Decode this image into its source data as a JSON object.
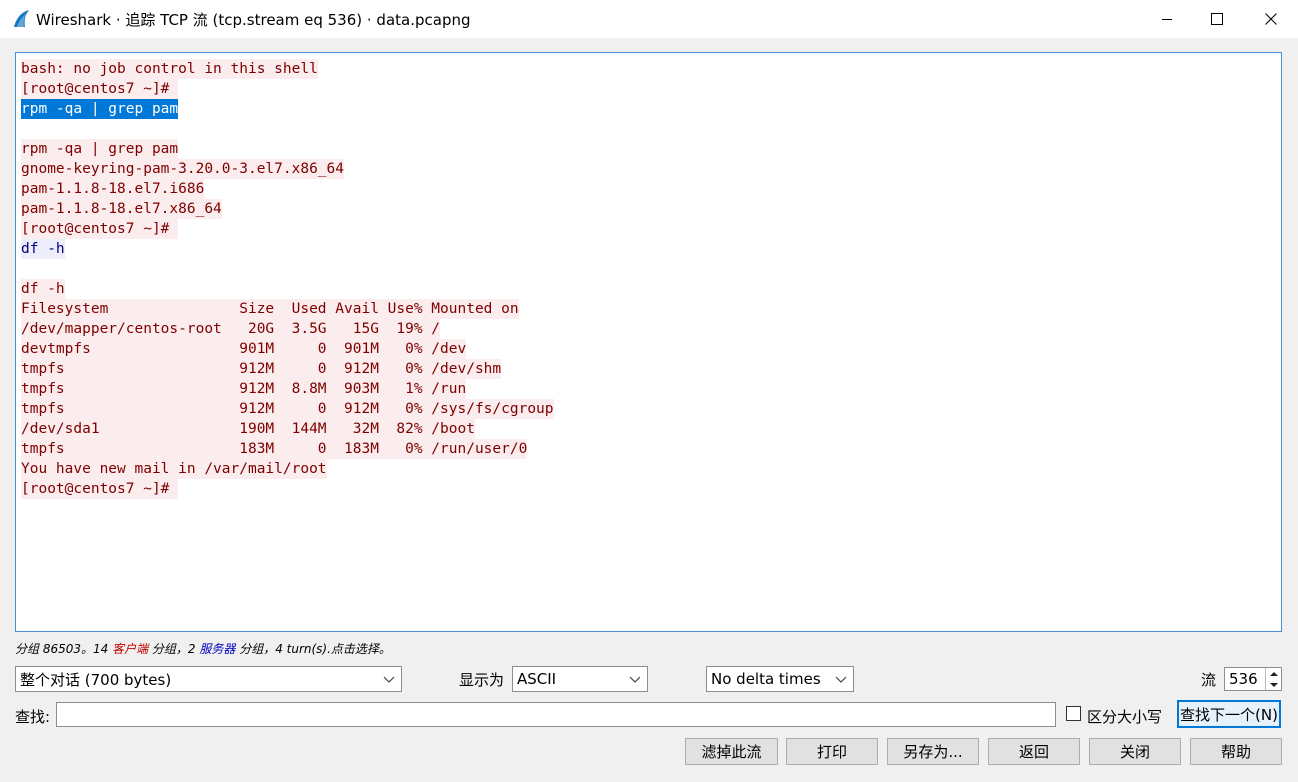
{
  "window": {
    "title": "Wireshark · 追踪 TCP 流 (tcp.stream eq 536) · data.pcapng",
    "icon": "wireshark-fin-icon",
    "controls": [
      "minimize-icon",
      "maximize-icon",
      "close-icon"
    ]
  },
  "stream": {
    "lines": [
      [
        {
          "text": "bash: no job control in this shell",
          "dir": "client"
        }
      ],
      [
        {
          "text": "[root@centos7 ~]# ",
          "dir": "client"
        }
      ],
      [
        {
          "text": "rpm -qa | grep pam",
          "dir": "sel"
        }
      ],
      [],
      [
        {
          "text": "rpm -qa | grep pam",
          "dir": "client"
        }
      ],
      [
        {
          "text": "gnome-keyring-pam-3.20.0-3.el7.x86_64",
          "dir": "client"
        }
      ],
      [
        {
          "text": "pam-1.1.8-18.el7.i686",
          "dir": "client"
        }
      ],
      [
        {
          "text": "pam-1.1.8-18.el7.x86_64",
          "dir": "client"
        }
      ],
      [
        {
          "text": "[root@centos7 ~]# ",
          "dir": "client"
        }
      ],
      [
        {
          "text": "df -h",
          "dir": "server"
        }
      ],
      [],
      [
        {
          "text": "df -h",
          "dir": "client"
        }
      ],
      [
        {
          "text": "Filesystem               Size  Used Avail Use% Mounted on",
          "dir": "client"
        }
      ],
      [
        {
          "text": "/dev/mapper/centos-root   20G  3.5G   15G  19% /",
          "dir": "client"
        }
      ],
      [
        {
          "text": "devtmpfs                 901M     0  901M   0% /dev",
          "dir": "client"
        }
      ],
      [
        {
          "text": "tmpfs                    912M     0  912M   0% /dev/shm",
          "dir": "client"
        }
      ],
      [
        {
          "text": "tmpfs                    912M  8.8M  903M   1% /run",
          "dir": "client"
        }
      ],
      [
        {
          "text": "tmpfs                    912M     0  912M   0% /sys/fs/cgroup",
          "dir": "client"
        }
      ],
      [
        {
          "text": "/dev/sda1                190M  144M   32M  82% /boot",
          "dir": "client"
        }
      ],
      [
        {
          "text": "tmpfs                    183M     0  183M   0% /run/user/0",
          "dir": "client"
        }
      ],
      [
        {
          "text": "You have new mail in /var/mail/root",
          "dir": "client"
        }
      ],
      [
        {
          "text": "[root@centos7 ~]# ",
          "dir": "client"
        }
      ]
    ]
  },
  "summary": {
    "part1": "分组 86503。14 ",
    "client": "客户端",
    "part2": " 分组，2 ",
    "server": "服务器",
    "part3": " 分组，4 turn(s).点击选择。"
  },
  "controls": {
    "conversation_select": "整个对话 (700 bytes)",
    "show_as_label": "显示为",
    "show_as_value": "ASCII",
    "delta_value": "No delta times",
    "stream_label": "流",
    "stream_value": "536"
  },
  "find": {
    "label": "查找:",
    "value": "",
    "case_label": "区分大小写",
    "next_button": "查找下一个(N)"
  },
  "buttons": {
    "filter_out": "滤掉此流",
    "print": "打印",
    "save_as": "另存为...",
    "back": "返回",
    "close": "关闭",
    "help": "帮助"
  }
}
